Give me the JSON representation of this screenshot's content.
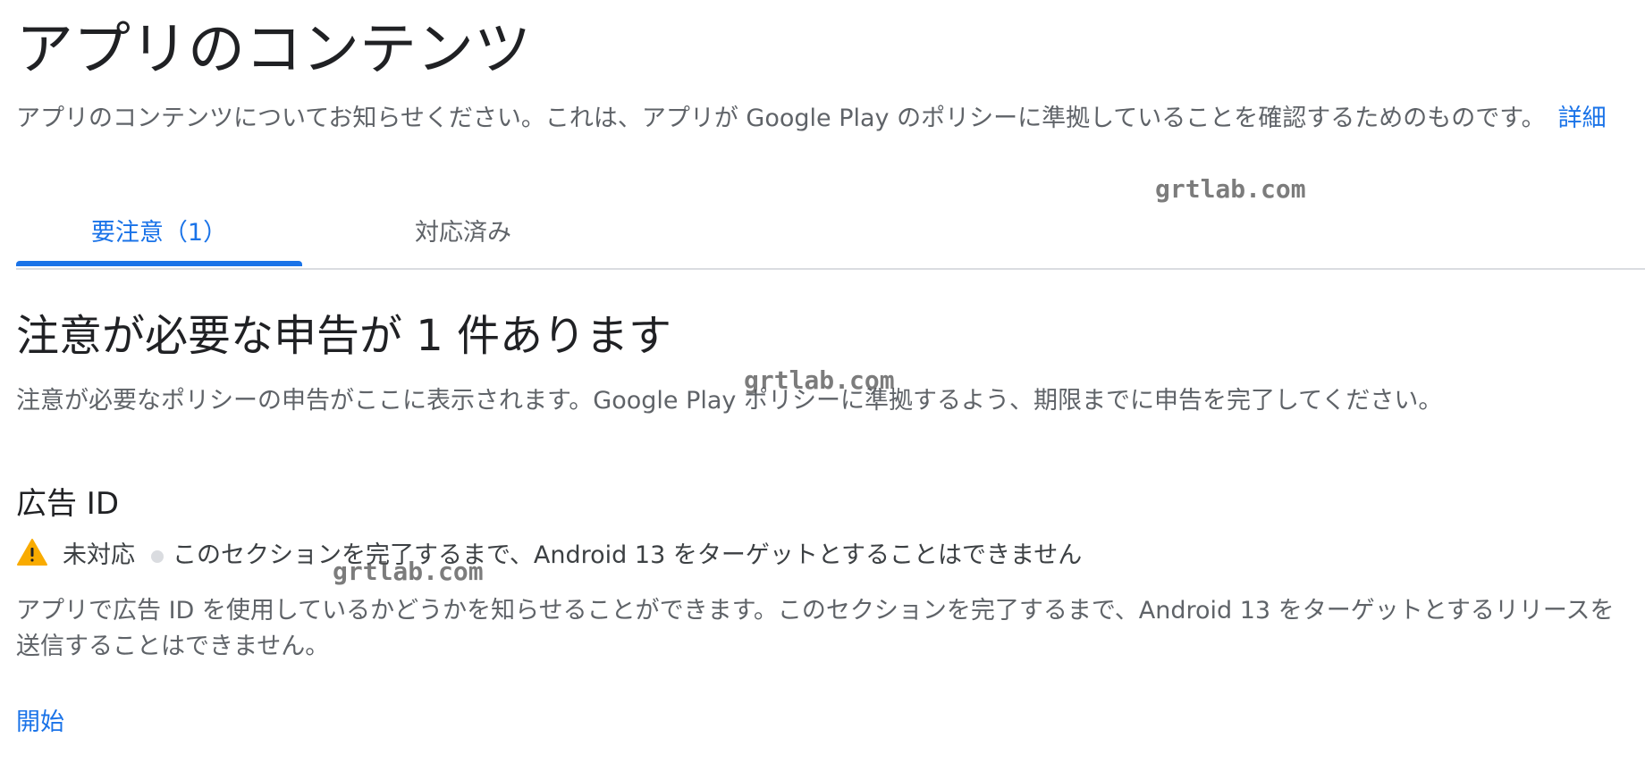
{
  "header": {
    "title": "アプリのコンテンツ",
    "description": "アプリのコンテンツについてお知らせください。これは、アプリが Google Play のポリシーに準拠していることを確認するためのものです。",
    "learn_more_label": "詳細"
  },
  "tabs": [
    {
      "label": "要注意（1）",
      "selected": true
    },
    {
      "label": "対応済み",
      "selected": false
    }
  ],
  "attention": {
    "heading": "注意が必要な申告が 1 件あります",
    "description": "注意が必要なポリシーの申告がここに表示されます。Google Play ポリシーに準拠するよう、期限までに申告を完了してください。"
  },
  "card": {
    "title": "広告 ID",
    "status": "未対応",
    "status_note": "このセクションを完了するまで、Android 13 をターゲットとすることはできません",
    "description": "アプリで広告 ID を使用しているかどうかを知らせることができます。このセクションを完了するまで、Android 13 をターゲットとするリリースを送信することはできません。",
    "start_label": "開始",
    "warning_icon": "warning-triangle",
    "warning_color": "#f9ab00"
  },
  "watermark": "grtlab.com",
  "colors": {
    "accent": "#1a73e8",
    "text_primary": "#202124",
    "text_secondary": "#5f6368",
    "divider": "#dadce0"
  }
}
